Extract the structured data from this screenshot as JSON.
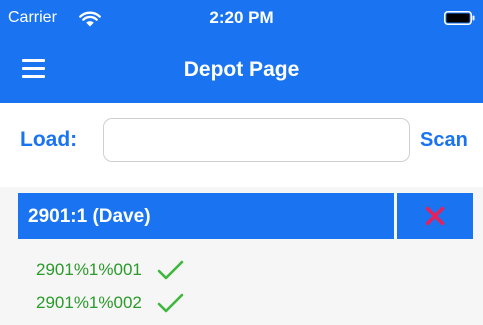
{
  "status_bar": {
    "carrier": "Carrier",
    "time": "2:20 PM"
  },
  "nav": {
    "title": "Depot Page"
  },
  "load_form": {
    "label": "Load:",
    "input_value": "",
    "scan_label": "Scan"
  },
  "loads": [
    {
      "label": "2901:1  (Dave)",
      "items": [
        {
          "label": "2901%1%001",
          "status": "checked"
        },
        {
          "label": "2901%1%002",
          "status": "checked"
        }
      ]
    }
  ],
  "colors": {
    "accent": "#1a74f2",
    "delete": "#e8205a",
    "check": "#3db83d",
    "item_text": "#2a9a2a"
  }
}
